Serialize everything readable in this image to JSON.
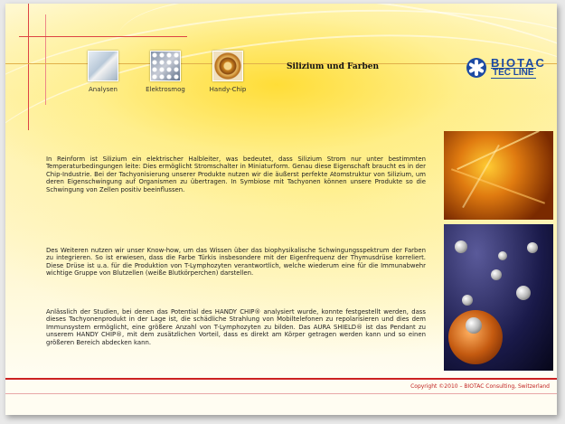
{
  "nav": {
    "items": [
      {
        "label": "Analysen",
        "icon": "microscope-icon"
      },
      {
        "label": "Elektrosmog",
        "icon": "network-icon"
      },
      {
        "label": "Handy-Chip",
        "icon": "chip-icon"
      }
    ]
  },
  "page": {
    "title": "Silizium und Farben"
  },
  "logo": {
    "line1": "BIOTAC",
    "line2": "TEC LINE"
  },
  "content": {
    "paragraph1": "In Reinform ist Silizium ein elektrischer Halbleiter, was bedeutet, dass Silizium Strom nur unter bestimmten Temperaturbedingungen leite: Dies ermöglicht Stromschalter in Miniaturform. Genau diese Eigenschaft braucht es in der Chip-Industrie. Bei der Tachyonisierung unserer Produkte nutzen wir die äußerst perfekte Atomstruktur von Silizium, um deren Eigenschwingung auf Organismen zu übertragen. In Symbiose mit Tachyonen können unsere Produkte so die Schwingung von Zellen positiv beeinflussen.",
    "paragraph2": "Des Weiteren nutzen wir unser Know-how, um das Wissen über das biophysikalische Schwingungsspektrum der Farben zu integrieren. So ist erwiesen, dass die Farbe Türkis insbesondere mit der Eigenfrequenz der Thymusdrüse korreliert. Diese Drüse ist u.a. für die Produktion von T-Lymphozyten verantwortlich, welche wiederum eine für die Immunabwehr wichtige Gruppe von Blutzellen (weiße Blutkörperchen) darstellen.",
    "paragraph3": "Anlässlich der Studien, bei denen das Potential des HANDY CHIP® analysiert wurde, konnte festgestellt werden, dass dieses Tachyonenprodukt in der Lage ist, die schädliche Strahlung von Mobiltelefonen zu repolarisieren und dies dem Immunsystem ermöglicht, eine größere Anzahl von T-Lymphozyten zu bilden. Das AURA SHIELD® ist das Pendant zu unserem HANDY CHIP®, mit dem zusätzlichen Vorteil, dass es direkt am Körper getragen werden kann und so einen größeren Bereich abdecken kann."
  },
  "footer": {
    "copyright": "Copyright ©2010 – BIOTAC Consulting, Switzerland"
  },
  "colors": {
    "accent_red": "#cc2222",
    "brand_blue": "#1c4aa3",
    "background_yellow": "#ffe24a"
  }
}
